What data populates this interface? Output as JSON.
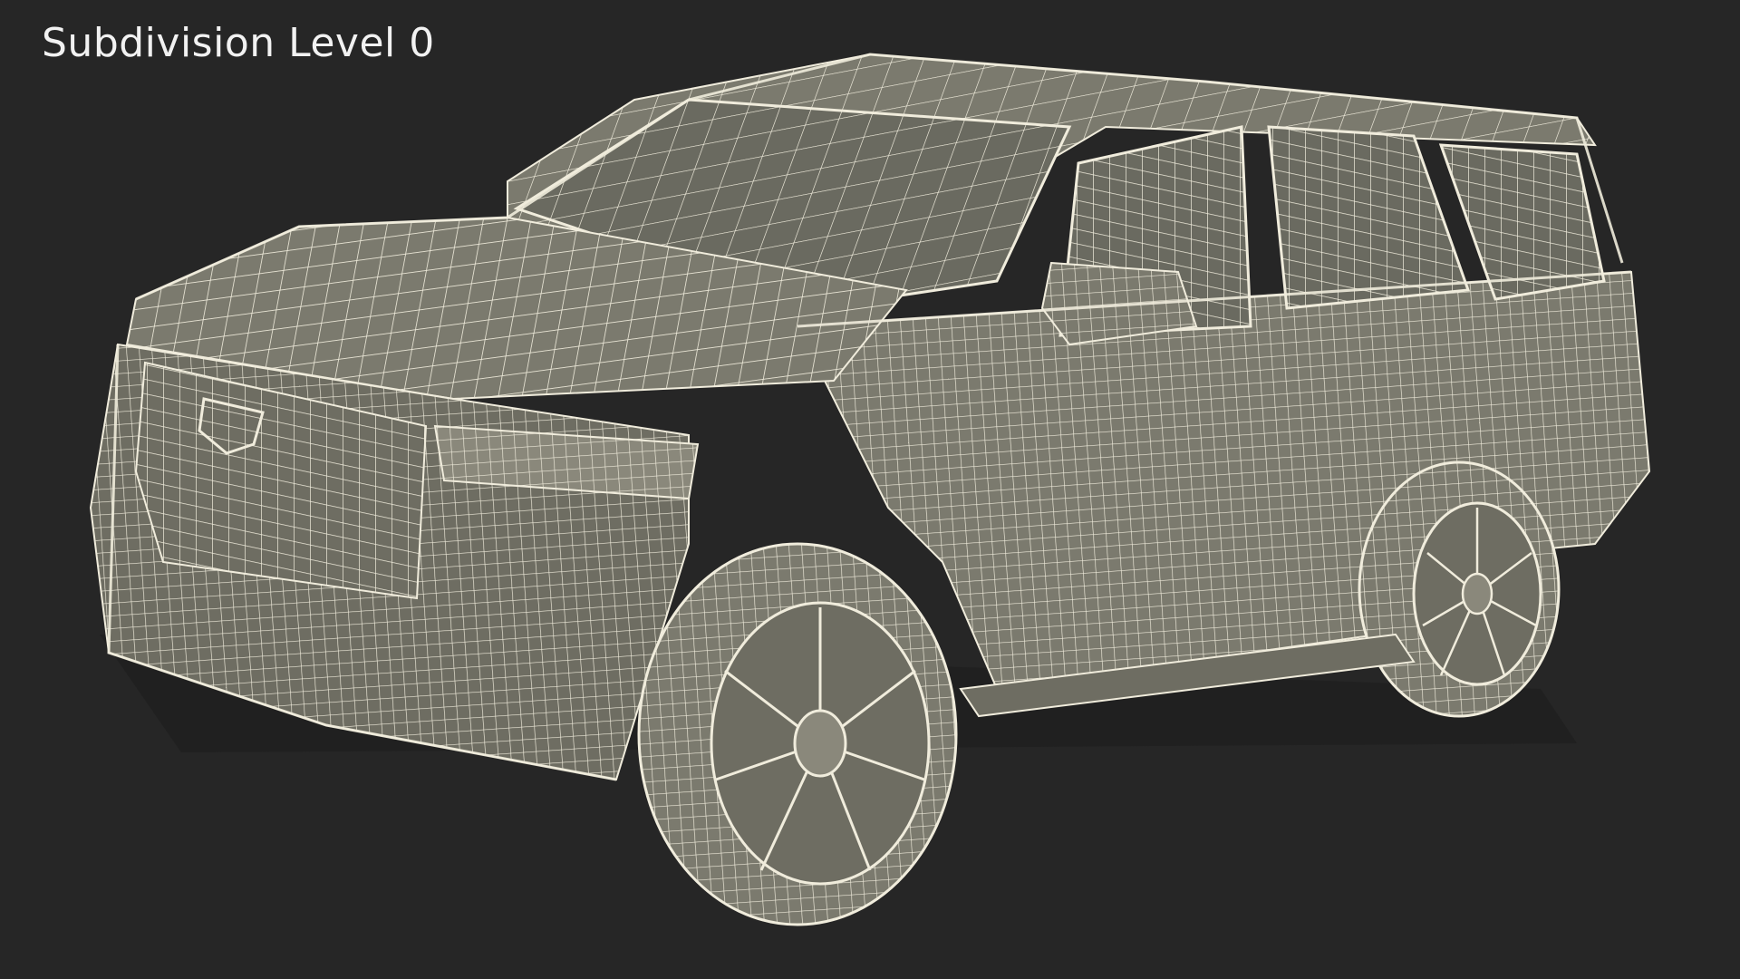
{
  "viewport": {
    "label": "Subdivision Level 0",
    "background_color": "#262626",
    "body_color": "#7b7a6e",
    "body_shade_color": "#6e6d62",
    "wire_color": "#f0ecdc",
    "glass_color": "#6a6a60"
  },
  "model": {
    "render_style": "wireframe-over-shaded"
  }
}
